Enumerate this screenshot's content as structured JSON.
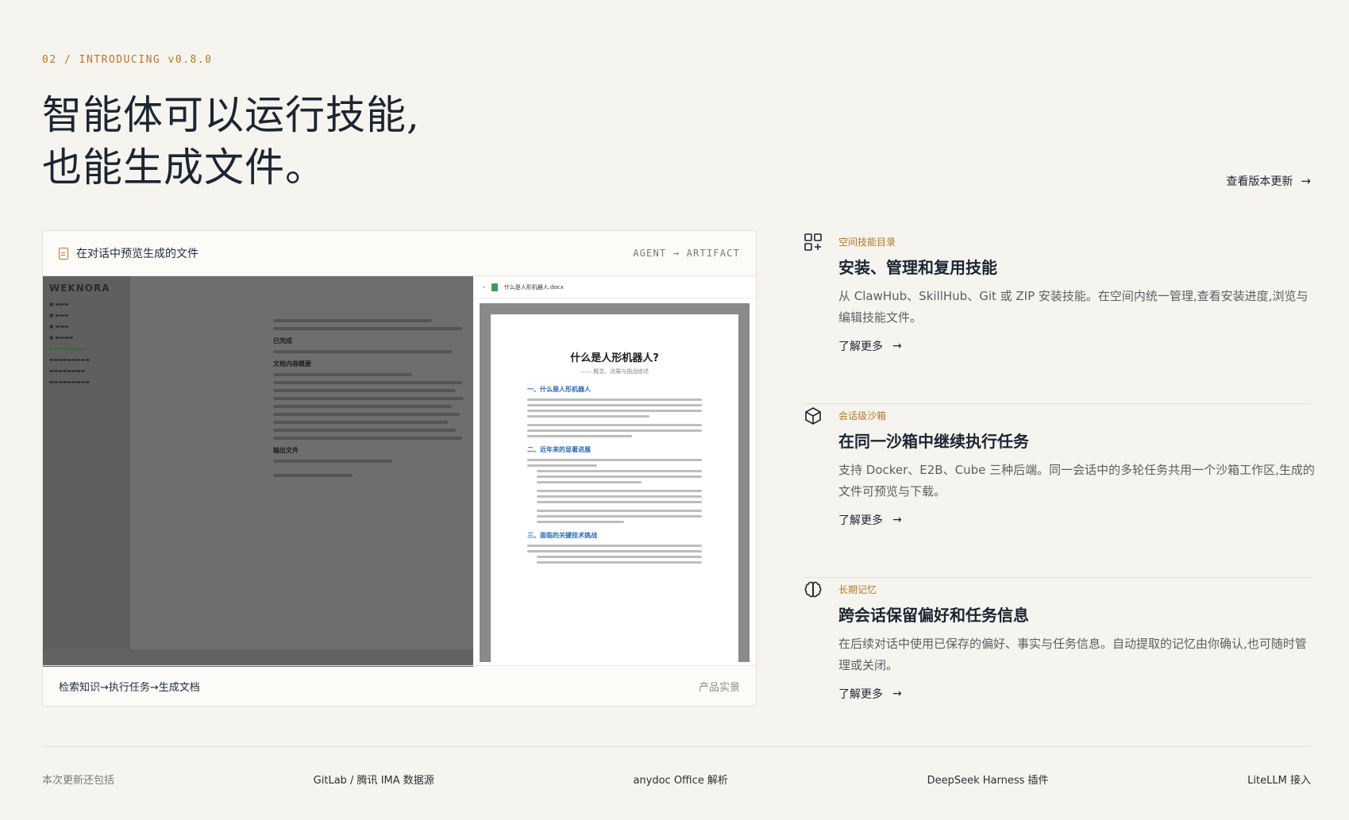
{
  "hero": {
    "eyebrow": "02 / INTRODUCING v0.8.0",
    "title_line1": "智能体可以运行技能,",
    "title_line2": "也能生成文件。",
    "release_link": "查看版本更新"
  },
  "preview_card": {
    "header_label": "在对话中预览生成的文件",
    "header_tag": "AGENT → ARTIFACT",
    "footer_flow": "检索知识→执行任务→生成文档",
    "footer_note": "产品实景",
    "app": {
      "logo": "WEKNORA",
      "doc_filename": "什么是人形机器人.docx",
      "doc_title": "什么是人形机器人?",
      "doc_subtitle": "—— 概念、进展与挑战综述",
      "doc_sections": [
        "一、什么是人形机器人",
        "二、近年来的显著进展",
        "三、面临的关键技术挑战"
      ],
      "chat_headings": [
        "已完成",
        "文档内容概要",
        "输出文件"
      ]
    }
  },
  "features": [
    {
      "icon": "grid-plus-icon",
      "tag": "空间技能目录",
      "title": "安装、管理和复用技能",
      "desc": "从 ClawHub、SkillHub、Git 或 ZIP 安装技能。在空间内统一管理,查看安装进度,浏览与编辑技能文件。",
      "more": "了解更多"
    },
    {
      "icon": "cube-icon",
      "tag": "会话级沙箱",
      "title": "在同一沙箱中继续执行任务",
      "desc": "支持 Docker、E2B、Cube 三种后端。同一会话中的多轮任务共用一个沙箱工作区,生成的文件可预览与下载。",
      "more": "了解更多"
    },
    {
      "icon": "brain-icon",
      "tag": "长期记忆",
      "title": "跨会话保留偏好和任务信息",
      "desc": "在后续对话中使用已保存的偏好、事实与任务信息。自动提取的记忆由你确认,也可随时管理或关闭。",
      "more": "了解更多"
    }
  ],
  "extras": {
    "lead": "本次更新还包括",
    "items": [
      "GitLab / 腾讯 IMA 数据源",
      "anydoc Office 解析",
      "DeepSeek Harness 插件",
      "LiteLLM 接入"
    ]
  },
  "colors": {
    "accent": "#b07a2c",
    "ink": "#1b2533",
    "background": "#f6f4ee"
  }
}
